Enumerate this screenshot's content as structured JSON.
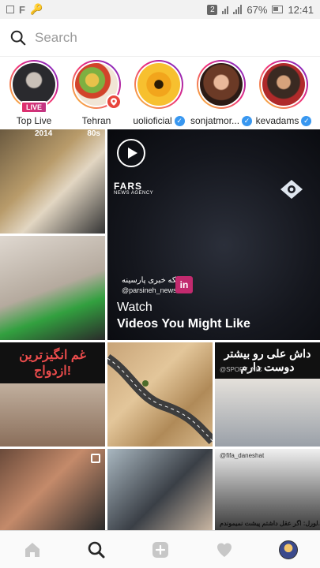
{
  "status_bar": {
    "notification_count": "2",
    "battery_percent": "67%",
    "time": "12:41"
  },
  "search": {
    "placeholder": "Search"
  },
  "stories": [
    {
      "label": "Top Live",
      "badge": "LIVE",
      "verified": false
    },
    {
      "label": "Tehran",
      "badge": "location-pin-icon",
      "verified": false
    },
    {
      "label": "uolioficial",
      "verified": true
    },
    {
      "label": "sonjatmor...",
      "verified": true
    },
    {
      "label": "kevadams",
      "verified": true
    }
  ],
  "feed": {
    "video": {
      "agency_logo": "FARS",
      "agency_sub": "NEWS AGENCY",
      "watermark_fa": "شبکه خبری پارسینه",
      "watermark_handle": "@parsineh_news",
      "watermark_logo": "in",
      "title": "Watch",
      "subtitle": "Videos You Might Like"
    },
    "tiles": {
      "t1_year_left": "2014",
      "t1_year_right": "80s",
      "t3_headline": "غم انگیزترین ازدواج!",
      "t5_headline": "داش علی رو بیشتر دوست دارم",
      "t5_handle": "@SPORT_NIC",
      "t8_handle": "@fifa_daneshat",
      "t8_caption": "لورل: اگر عقل داشتم پیشت نمیموندم."
    }
  },
  "nav": {
    "items": [
      "home-icon",
      "search-icon",
      "add-post-icon",
      "activity-heart-icon",
      "profile-avatar"
    ]
  },
  "colors": {
    "story_ring_start": "#f9ce34",
    "story_ring_mid": "#ee2a7b",
    "story_ring_end": "#6228d7",
    "verified_blue": "#3897f0",
    "live_pink": "#e1306c"
  }
}
